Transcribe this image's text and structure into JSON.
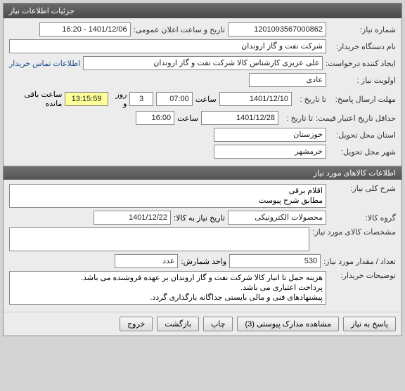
{
  "window": {
    "title": "جزئیات اطلاعات نیاز"
  },
  "need": {
    "labels": {
      "need_no": "شماره نیاز:",
      "public_date": "تاریخ و ساعت اعلان عمومی:",
      "buyer_org": "نام دستگاه خریدار:",
      "requester": "ایجاد کننده درخواست:",
      "contact_link": "اطلاعات تماس خریدار",
      "priority": "اولویت نیاز :",
      "reply_deadline": "مهلت ارسال پاسخ:",
      "to_date1": "تا تاریخ :",
      "hour": "ساعت",
      "days_and": "روز و",
      "hours_remain": "ساعت باقی مانده",
      "valid_min": "حداقل تاریخ اعتبار قیمت:",
      "to_date2": "تا تاریخ :",
      "delivery_province": "استان محل تحویل:",
      "delivery_city": "شهر محل تحویل:"
    },
    "need_no": "1201093567000862",
    "public_date": "1401/12/06 - 16:20",
    "buyer_org": "شرکت نفت و گاز اروندان",
    "requester": "علی عزیزی کارشناس کالا شرکت نفت و گاز اروندان",
    "priority": "عادی",
    "reply_to_date": "1401/12/10",
    "reply_hour": "07:00",
    "days_remain": "3",
    "hours_remain": "13:15:59",
    "valid_to_date": "1401/12/28",
    "valid_hour": "16:00",
    "province": "خوزستان",
    "city": "خرمشهر"
  },
  "goods": {
    "header": "اطلاعات کالاهای مورد نیاز",
    "labels": {
      "general_desc": "شرح کلی نیاز:",
      "group": "گروه کالا:",
      "need_date_to": "تاریخ نیاز به کالا:",
      "specs": "مشخصات کالای مورد نیاز:",
      "qty": "تعداد / مقدار مورد نیاز:",
      "unit": "واحد شمارش:",
      "buyer_notes": "توضیحات خریدار:"
    },
    "general_desc": "اقلام برقی\nمطابق شرح پیوست",
    "group": "محصولات الکترونیکی",
    "need_date": "1401/12/22",
    "specs": "",
    "qty": "530",
    "unit": "عدد",
    "buyer_notes": "هزینه حمل تا انبار کالا شرکت نفت و گاز اروندان بر عهده فروشنده می باشد.\nپرداخت اعتباری می باشد.\nپیشنهادهای فنی و مالی بایستی جداگانه بارگذاری گردد."
  },
  "footer": {
    "reply": "پاسخ به نیاز",
    "attachments": "مشاهده مدارک پیوستی (3)",
    "print": "چاپ",
    "back": "بازگشت",
    "exit": "خروج"
  }
}
